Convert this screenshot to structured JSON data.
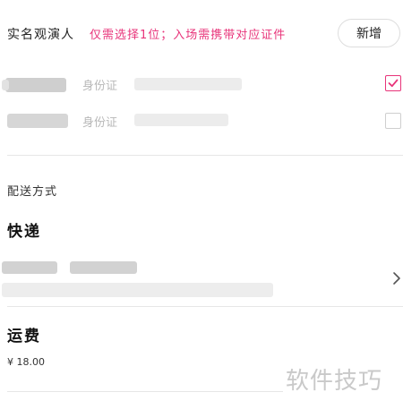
{
  "attendee": {
    "title": "实名观演人",
    "hint": "仅需选择1位；入场需携带对应证件",
    "add_label": "新增",
    "rows": [
      {
        "id_type": "身份证",
        "checked": true
      },
      {
        "id_type": "身份证",
        "checked": false
      }
    ]
  },
  "delivery": {
    "title": "配送方式",
    "method": "快递"
  },
  "shipping": {
    "label": "运费",
    "fee": "¥ 18.00"
  },
  "watermark": "软件技巧",
  "colors": {
    "accent": "#e8347a",
    "divider": "#e6e6e6",
    "blur": "#d6d6d6"
  },
  "icons": {
    "checked": "check-icon",
    "address": "chevron-right-icon"
  }
}
